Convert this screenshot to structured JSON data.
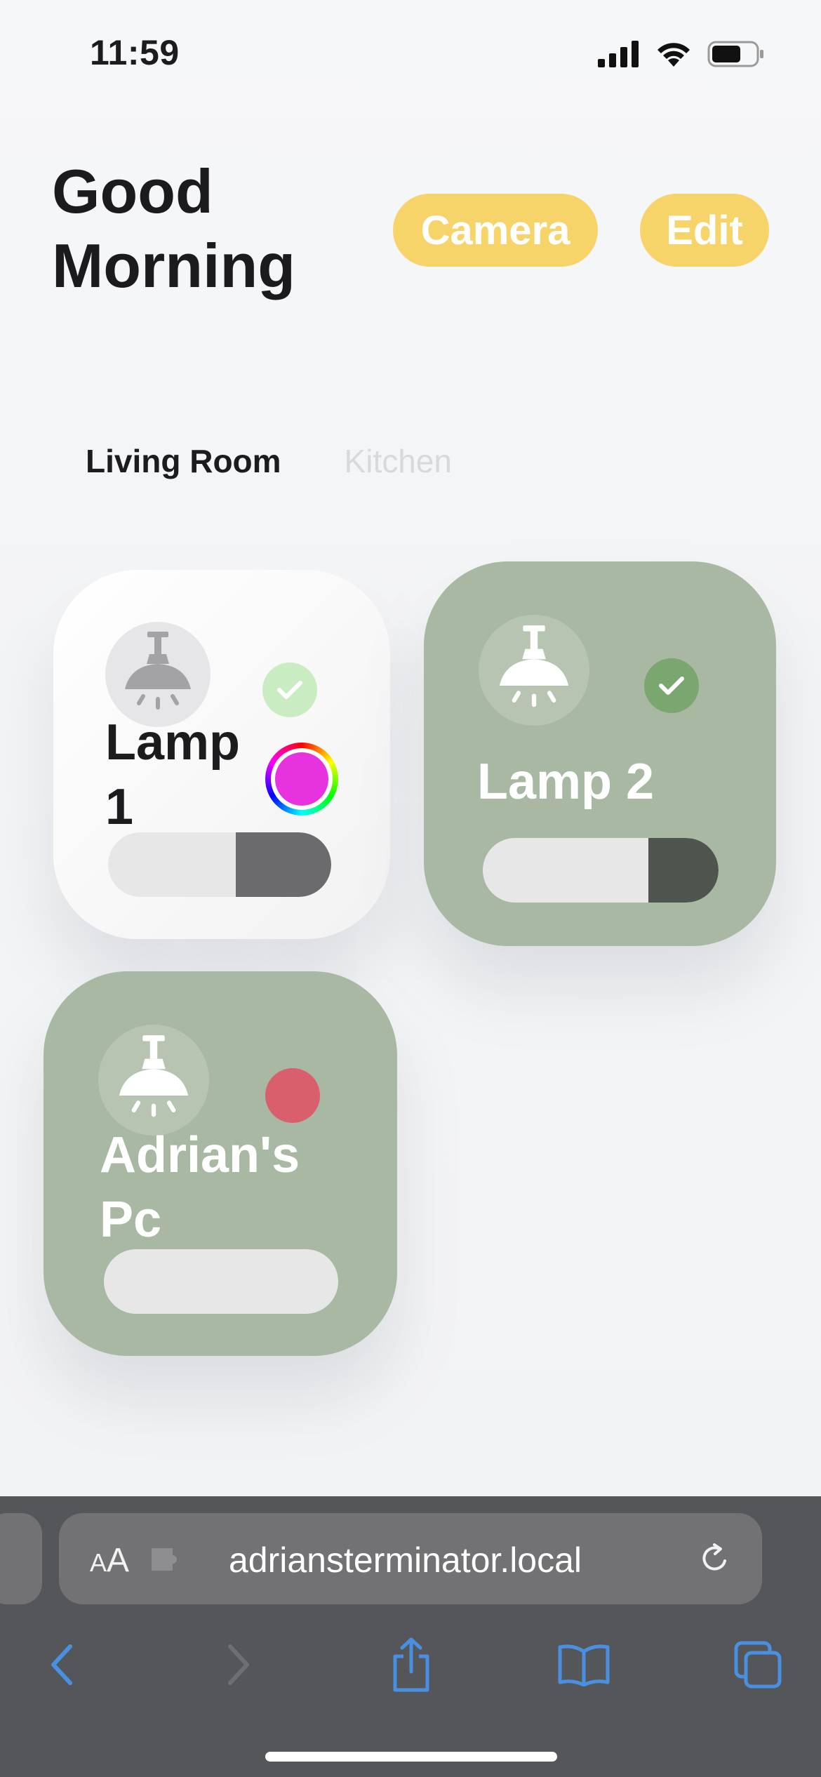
{
  "status_bar": {
    "time": "11:59"
  },
  "header": {
    "greeting": "Good Morning",
    "camera_label": "Camera",
    "edit_label": "Edit"
  },
  "colors": {
    "accent_button": "#f7d46a",
    "card_on": "#a8b8a2",
    "status_ok_on": "#7aa66f",
    "status_ok_off": "#c9ecc3",
    "status_error": "#d95f6d",
    "light_color": "#e633de"
  },
  "tabs": [
    {
      "label": "Living Room",
      "active": true
    },
    {
      "label": "Kitchen",
      "active": false
    }
  ],
  "devices": [
    {
      "name": "Lamp 1",
      "state": "off",
      "icon": "ceiling-lamp-icon",
      "status": "ok",
      "has_color": true,
      "brightness_percent": 43
    },
    {
      "name": "Lamp 2",
      "state": "on",
      "icon": "ceiling-lamp-icon",
      "status": "ok",
      "has_color": false,
      "brightness_percent": 30
    },
    {
      "name": "Adrian's Pc",
      "state": "on",
      "icon": "ceiling-lamp-icon",
      "status": "error",
      "has_color": false,
      "brightness_percent": 0
    }
  ],
  "browser": {
    "aa_label": "AA",
    "url": "adriansterminator.local"
  }
}
